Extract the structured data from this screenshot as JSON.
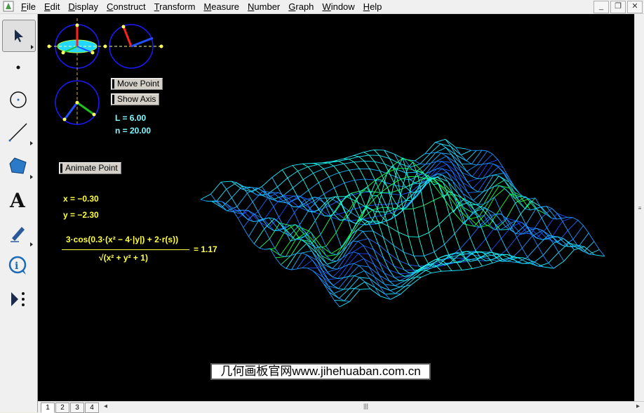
{
  "menu": [
    "File",
    "Edit",
    "Display",
    "Construct",
    "Transform",
    "Measure",
    "Number",
    "Graph",
    "Window",
    "Help"
  ],
  "window_buttons": {
    "minimize": "_",
    "restore": "❐",
    "close": "✕"
  },
  "toolbox": [
    {
      "name": "arrow-tool",
      "icon": "arrow-icon"
    },
    {
      "name": "point-tool",
      "icon": "point-icon"
    },
    {
      "name": "compass-tool",
      "icon": "circle-icon"
    },
    {
      "name": "straightedge-tool",
      "icon": "line-icon"
    },
    {
      "name": "polygon-tool",
      "icon": "polygon-icon"
    },
    {
      "name": "text-tool",
      "icon": "text-A-icon"
    },
    {
      "name": "marker-tool",
      "icon": "pen-icon"
    },
    {
      "name": "information-tool",
      "icon": "info-icon"
    },
    {
      "name": "custom-tool",
      "icon": "play-menu-icon"
    }
  ],
  "buttons": {
    "move_point": "Move Point",
    "show_axis": "Show Axis",
    "animate_point": "Animate Point"
  },
  "params": {
    "L": "L = 6.00",
    "n": "n = 20.00"
  },
  "coords": {
    "x": "x = −0.30",
    "y": "y = −2.30"
  },
  "formula": {
    "numerator": "3·cos(0.3·(x² − 4·|y|) + 2·r(s))",
    "denominator": "√(x² + y² + 1)",
    "result": "= 1.17"
  },
  "watermark": "几何画板官网www.jihehuaban.com.cn",
  "pages": [
    "1",
    "2",
    "3",
    "4"
  ],
  "colors": {
    "canvas": "#000000",
    "label_cyan": "#7ff8ff",
    "label_yellow": "#ffff40"
  }
}
